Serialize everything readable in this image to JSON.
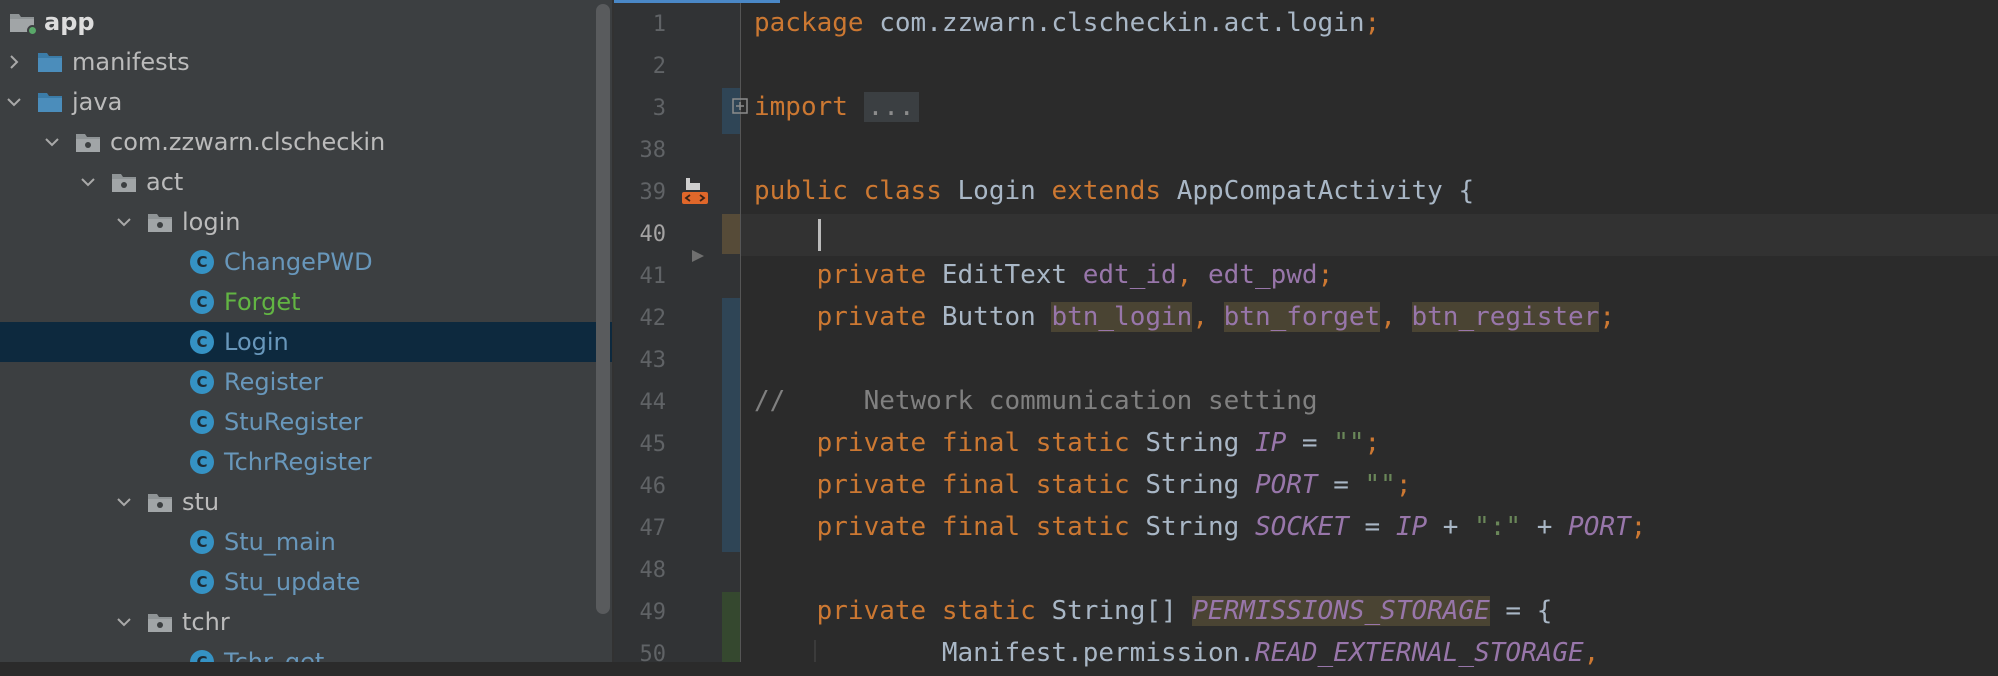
{
  "project_tree": {
    "items": [
      {
        "label": "app",
        "kind": "module",
        "expanded": true
      },
      {
        "label": "manifests",
        "kind": "folder",
        "expanded": false
      },
      {
        "label": "java",
        "kind": "folder",
        "expanded": true
      },
      {
        "label": "com.zzwarn.clscheckin",
        "kind": "package",
        "expanded": true
      },
      {
        "label": "act",
        "kind": "package",
        "expanded": true
      },
      {
        "label": "login",
        "kind": "package",
        "expanded": true
      },
      {
        "label": "ChangePWD",
        "kind": "class"
      },
      {
        "label": "Forget",
        "kind": "class"
      },
      {
        "label": "Login",
        "kind": "class",
        "selected": true
      },
      {
        "label": "Register",
        "kind": "class"
      },
      {
        "label": "StuRegister",
        "kind": "class"
      },
      {
        "label": "TchrRegister",
        "kind": "class"
      },
      {
        "label": "stu",
        "kind": "package",
        "expanded": true
      },
      {
        "label": "Stu_main",
        "kind": "class"
      },
      {
        "label": "Stu_update",
        "kind": "class"
      },
      {
        "label": "tchr",
        "kind": "package",
        "expanded": true
      },
      {
        "label": "Tchr_get",
        "kind": "class"
      }
    ]
  },
  "editor": {
    "current_line": "40",
    "line_numbers": [
      "1",
      "2",
      "3",
      "38",
      "39",
      "40",
      "41",
      "42",
      "43",
      "44",
      "45",
      "46",
      "47",
      "48",
      "49",
      "50"
    ],
    "code": {
      "l1_kw": "package",
      "l1_rest": " com.zzwarn.clscheckin.act.login",
      "l1_semi": ";",
      "l3_kw": "import",
      "l3_fold": "...",
      "l39_kw1": "public",
      "l39_kw2": "class",
      "l39_name": "Login",
      "l39_kw3": "extends",
      "l39_rest": "AppCompatActivity {",
      "l41_kw": "private",
      "l41_type": "EditText",
      "l41_f1": "edt_id",
      "l41_f2": "edt_pwd",
      "l42_kw": "private",
      "l42_type": "Button",
      "l42_f1": "btn_login",
      "l42_f2": "btn_forget",
      "l42_f3": "btn_register",
      "l44_comment": "//     Network communication setting",
      "l45_kw": "private final static",
      "l45_type": "String",
      "l45_f": "IP",
      "l45_eq": "=",
      "l45_str": "\"\"",
      "l46_kw": "private final static",
      "l46_type": "String",
      "l46_f": "PORT",
      "l46_eq": "=",
      "l46_str": "\"\"",
      "l47_kw": "private final static",
      "l47_type": "String",
      "l47_f": "SOCKET",
      "l47_eq": "=",
      "l47_f2": "IP",
      "l47_plus1": "+",
      "l47_str": "\":\"",
      "l47_plus2": "+",
      "l47_f3": "PORT",
      "l49_kw": "private static",
      "l49_type": "String[]",
      "l49_f": "PERMISSIONS_STORAGE",
      "l49_rest": "= {",
      "l50_pre": "Manifest.permission.",
      "l50_f": "READ_EXTERNAL_STORAGE",
      "l50_post": ","
    }
  },
  "colors": {
    "keyword": "#cc7832",
    "string": "#6a8759",
    "comment": "#808080",
    "field": "#9876aa",
    "plain": "#a9b7c6",
    "tree_class_label": "#6897bb",
    "tree_modified_label": "#62b543",
    "selection": "#0d293e"
  }
}
